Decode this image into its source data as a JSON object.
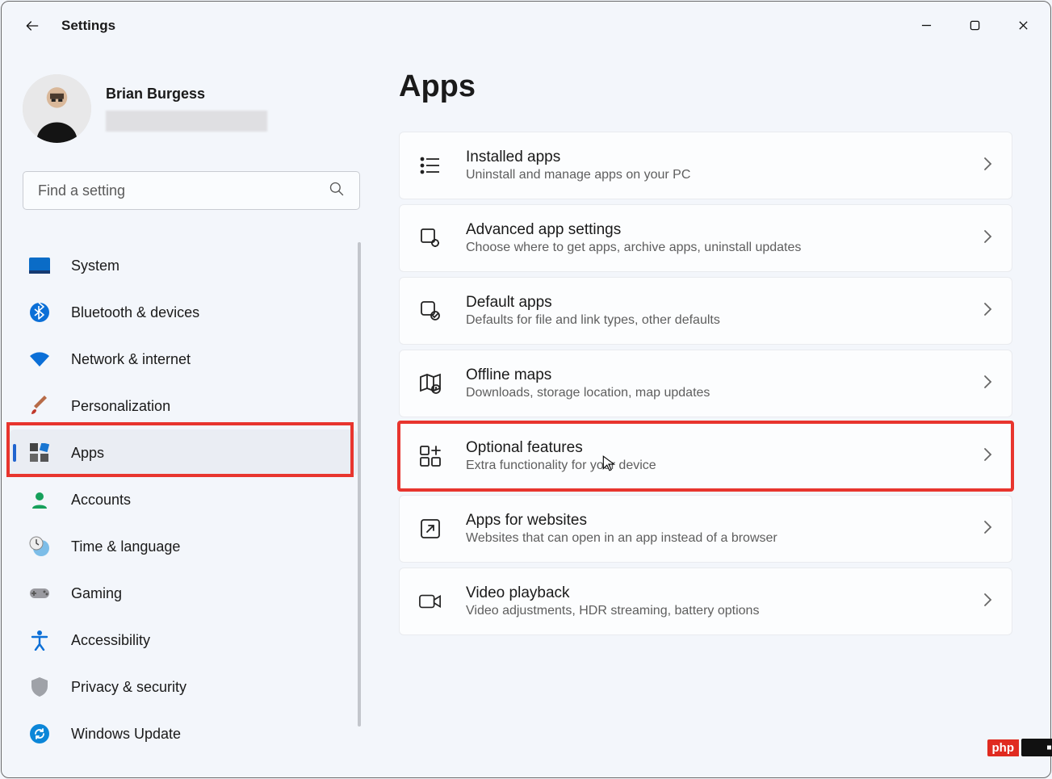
{
  "window": {
    "title": "Settings"
  },
  "profile": {
    "name": "Brian Burgess"
  },
  "search": {
    "placeholder": "Find a setting"
  },
  "sidebar": {
    "items": [
      {
        "label": "System"
      },
      {
        "label": "Bluetooth & devices"
      },
      {
        "label": "Network & internet"
      },
      {
        "label": "Personalization"
      },
      {
        "label": "Apps"
      },
      {
        "label": "Accounts"
      },
      {
        "label": "Time & language"
      },
      {
        "label": "Gaming"
      },
      {
        "label": "Accessibility"
      },
      {
        "label": "Privacy & security"
      },
      {
        "label": "Windows Update"
      }
    ]
  },
  "main": {
    "title": "Apps",
    "cards": [
      {
        "title": "Installed apps",
        "sub": "Uninstall and manage apps on your PC"
      },
      {
        "title": "Advanced app settings",
        "sub": "Choose where to get apps, archive apps, uninstall updates"
      },
      {
        "title": "Default apps",
        "sub": "Defaults for file and link types, other defaults"
      },
      {
        "title": "Offline maps",
        "sub": "Downloads, storage location, map updates"
      },
      {
        "title": "Optional features",
        "sub": "Extra functionality for your device"
      },
      {
        "title": "Apps for websites",
        "sub": "Websites that can open in an app instead of a browser"
      },
      {
        "title": "Video playback",
        "sub": "Video adjustments, HDR streaming, battery options"
      }
    ]
  },
  "badge": {
    "text": "php"
  }
}
